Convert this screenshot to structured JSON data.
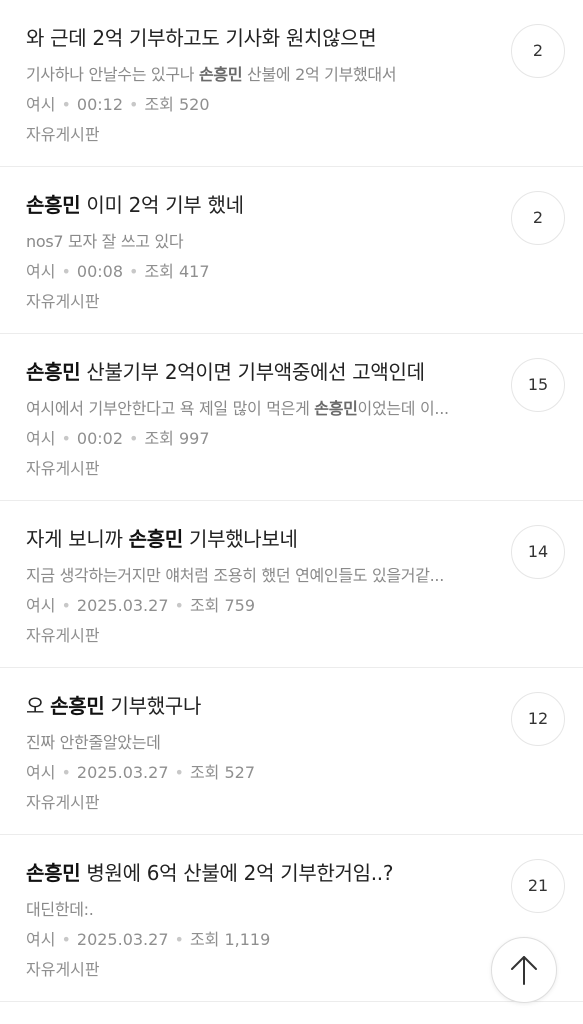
{
  "posts": [
    {
      "title_parts": [
        {
          "text": "와 근데 2억 기부하고도 기사화 원치않으면",
          "bold": false
        }
      ],
      "preview_parts": [
        {
          "text": "기사하나 안날수는 있구나 ",
          "bold": false
        },
        {
          "text": "손흥민",
          "bold": true
        },
        {
          "text": " 산불에 2억 기부했대서",
          "bold": false
        }
      ],
      "author": "여시",
      "time": "00:12",
      "views": "조회 520",
      "board": "자유게시판",
      "comments": "2"
    },
    {
      "title_parts": [
        {
          "text": "손흥민",
          "bold": true
        },
        {
          "text": " 이미 2억 기부 했네",
          "bold": false
        }
      ],
      "preview_parts": [
        {
          "text": "nos7 모자 잘 쓰고 있다",
          "bold": false
        }
      ],
      "author": "여시",
      "time": "00:08",
      "views": "조회 417",
      "board": "자유게시판",
      "comments": "2"
    },
    {
      "title_parts": [
        {
          "text": "손흥민",
          "bold": true
        },
        {
          "text": " 산불기부 2억이면 기부액중에선 고액인데",
          "bold": false
        }
      ],
      "preview_parts": [
        {
          "text": "여시에서 기부안한다고 욕 제일 많이 먹은게 ",
          "bold": false
        },
        {
          "text": "손흥민",
          "bold": true
        },
        {
          "text": "이었는데 이...",
          "bold": false
        }
      ],
      "author": "여시",
      "time": "00:02",
      "views": "조회 997",
      "board": "자유게시판",
      "comments": "15"
    },
    {
      "title_parts": [
        {
          "text": "자게 보니까 ",
          "bold": false
        },
        {
          "text": "손흥민",
          "bold": true
        },
        {
          "text": " 기부했나보네",
          "bold": false
        }
      ],
      "preview_parts": [
        {
          "text": "지금 생각하는거지만 얘처럼 조용히 했던 연예인들도 있을거같...",
          "bold": false
        }
      ],
      "author": "여시",
      "time": "2025.03.27",
      "views": "조회 759",
      "board": "자유게시판",
      "comments": "14"
    },
    {
      "title_parts": [
        {
          "text": "오 ",
          "bold": false
        },
        {
          "text": "손흥민",
          "bold": true
        },
        {
          "text": " 기부했구나",
          "bold": false
        }
      ],
      "preview_parts": [
        {
          "text": "진짜 안한줄알았는데",
          "bold": false
        }
      ],
      "author": "여시",
      "time": "2025.03.27",
      "views": "조회 527",
      "board": "자유게시판",
      "comments": "12"
    },
    {
      "title_parts": [
        {
          "text": "손흥민",
          "bold": true
        },
        {
          "text": " 병원에 6억 산불에 2억 기부한거임..?",
          "bold": false
        }
      ],
      "preview_parts": [
        {
          "text": "대딘한데:.",
          "bold": false
        }
      ],
      "author": "여시",
      "time": "2025.03.27",
      "views": "조회 1,119",
      "board": "자유게시판",
      "comments": "21"
    }
  ],
  "scroll_top_icon": "arrow-up-icon"
}
